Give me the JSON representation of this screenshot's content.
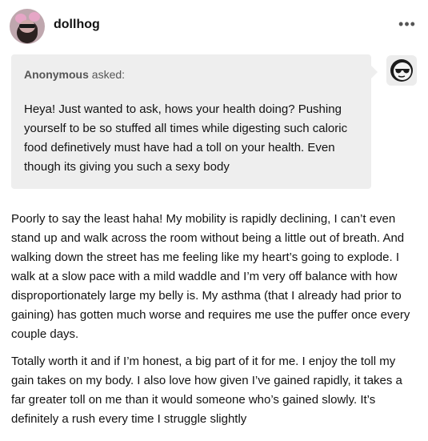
{
  "post": {
    "username": "dollhog",
    "more_label": "•••"
  },
  "ask": {
    "asker_name": "Anonymous",
    "asker_suffix": " asked:",
    "question": "Heya! Just wanted to ask, hows your health doing? Pushing yourself to be so stuffed all times while digesting such caloric food definetively must have had a toll on your health. Even though its giving you such a sexy body"
  },
  "answer": {
    "paragraphs": [
      "Poorly to say the least haha! My mobility is rapidly declining, I can’t even stand up and walk across the room without being a little out of breath. And walking down the street has me feeling like my heart’s going to explode. I walk at a slow pace with a mild waddle and I’m very off balance with how disproportionately large my belly is. My asthma (that I already had prior to gaining) has gotten much worse and requires me use the puffer once every couple days.",
      "Totally worth it and if I’m honest, a big part of it for me. I enjoy the toll my gain takes on my body. I also love how given I’ve gained rapidly, it takes a far greater toll on me than it would someone who’s gained slowly. It’s definitely a rush every time I struggle slightly"
    ]
  },
  "icons": {
    "avatar": "user-avatar",
    "anon": "anonymous-sunglasses-icon",
    "more": "more-dots-icon"
  }
}
